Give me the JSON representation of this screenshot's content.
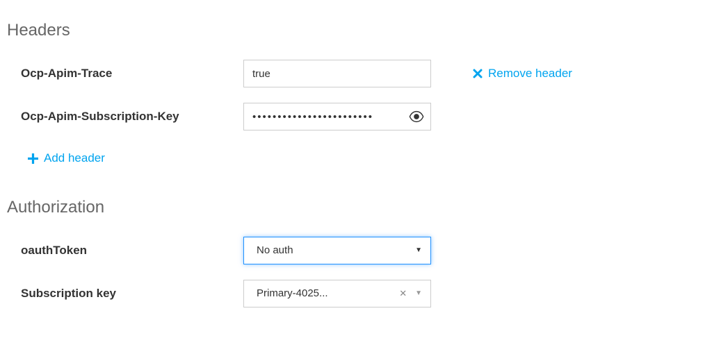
{
  "sections": {
    "headers_title": "Headers",
    "authorization_title": "Authorization"
  },
  "headers": {
    "row0": {
      "label": "Ocp-Apim-Trace",
      "value": "true",
      "remove_label": "Remove header"
    },
    "row1": {
      "label": "Ocp-Apim-Subscription-Key",
      "value": "••••••••••••••••••••••••"
    },
    "add_label": "Add header"
  },
  "authorization": {
    "oauth": {
      "label": "oauthToken",
      "selected": "No auth"
    },
    "subkey": {
      "label": "Subscription key",
      "selected": "Primary-4025..."
    }
  }
}
